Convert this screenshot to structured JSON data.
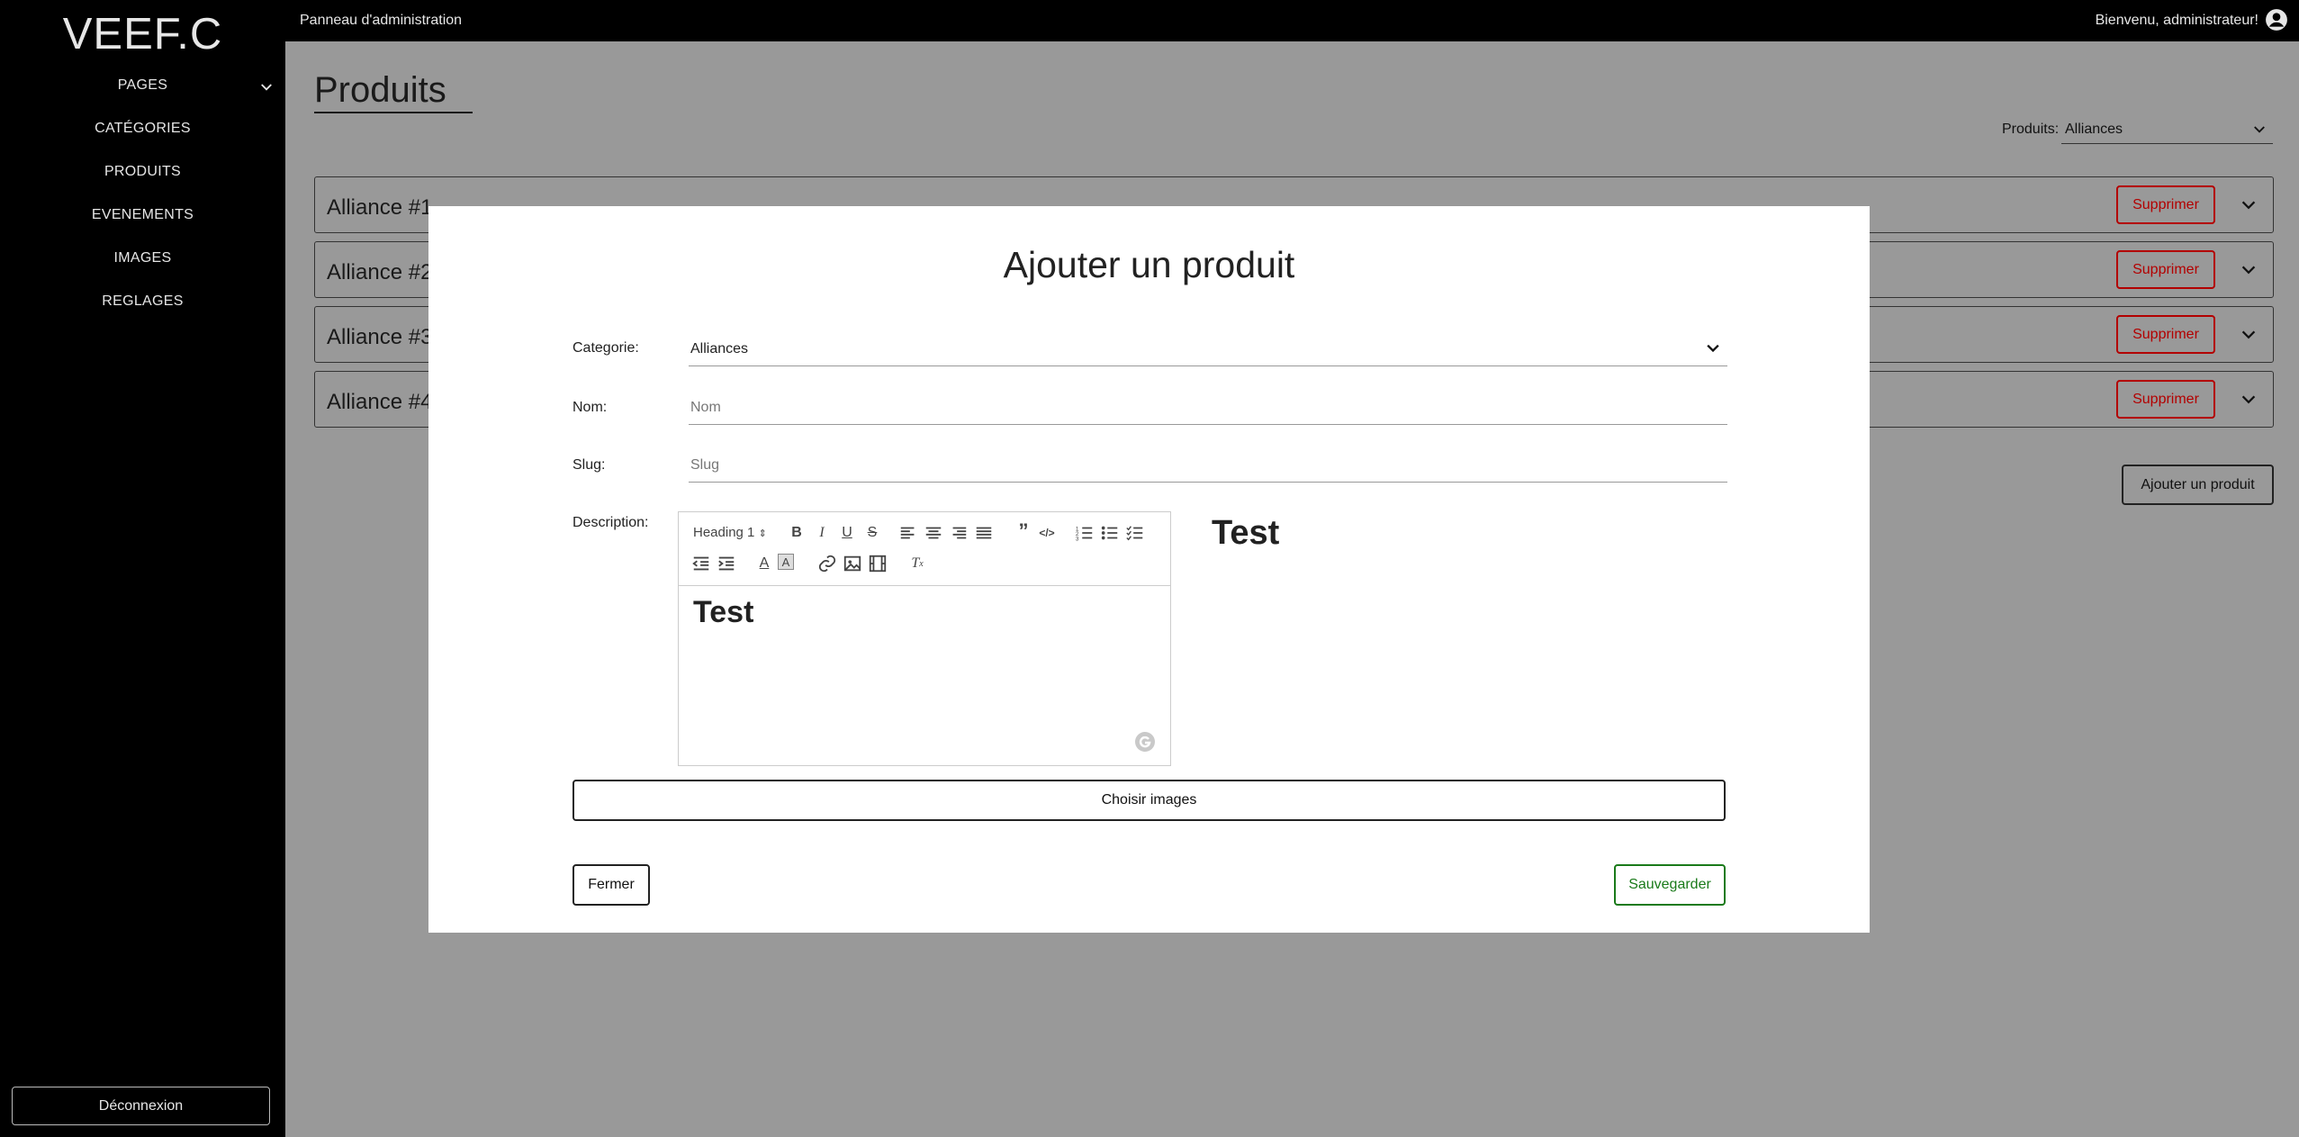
{
  "sidebar": {
    "logo": "VEEF.C",
    "items": [
      {
        "label": "PAGES"
      },
      {
        "label": "CATÉGORIES"
      },
      {
        "label": "PRODUITS"
      },
      {
        "label": "EVENEMENTS"
      },
      {
        "label": "IMAGES"
      },
      {
        "label": "REGLAGES"
      }
    ],
    "logout_label": "Déconnexion"
  },
  "topbar": {
    "title": "Panneau d'administration",
    "welcome": "Bienvenu, administrateur!",
    "user_icon": "user-circle-icon"
  },
  "main": {
    "title": "Produits",
    "filter_label": "Produits:",
    "filter_value": "Alliances",
    "products": [
      {
        "name": "Alliance #1",
        "delete_label": "Supprimer"
      },
      {
        "name": "Alliance #2",
        "delete_label": "Supprimer"
      },
      {
        "name": "Alliance #3",
        "delete_label": "Supprimer"
      },
      {
        "name": "Alliance #4",
        "delete_label": "Supprimer"
      }
    ],
    "add_label": "Ajouter un produit"
  },
  "modal": {
    "title": "Ajouter un produit",
    "category_label": "Categorie:",
    "category_value": "Alliances",
    "name_label": "Nom:",
    "name_placeholder": "Nom",
    "slug_label": "Slug:",
    "slug_placeholder": "Slug",
    "description_label": "Description:",
    "editor": {
      "heading_select": "Heading 1",
      "content": "Test"
    },
    "preview_content": "Test",
    "choose_images_label": "Choisir images",
    "close_label": "Fermer",
    "save_label": "Sauvegarder"
  },
  "colors": {
    "sidebar_bg": "#000000",
    "overlay": "#999999",
    "danger": "#b30000",
    "success": "#1a7a1a"
  }
}
